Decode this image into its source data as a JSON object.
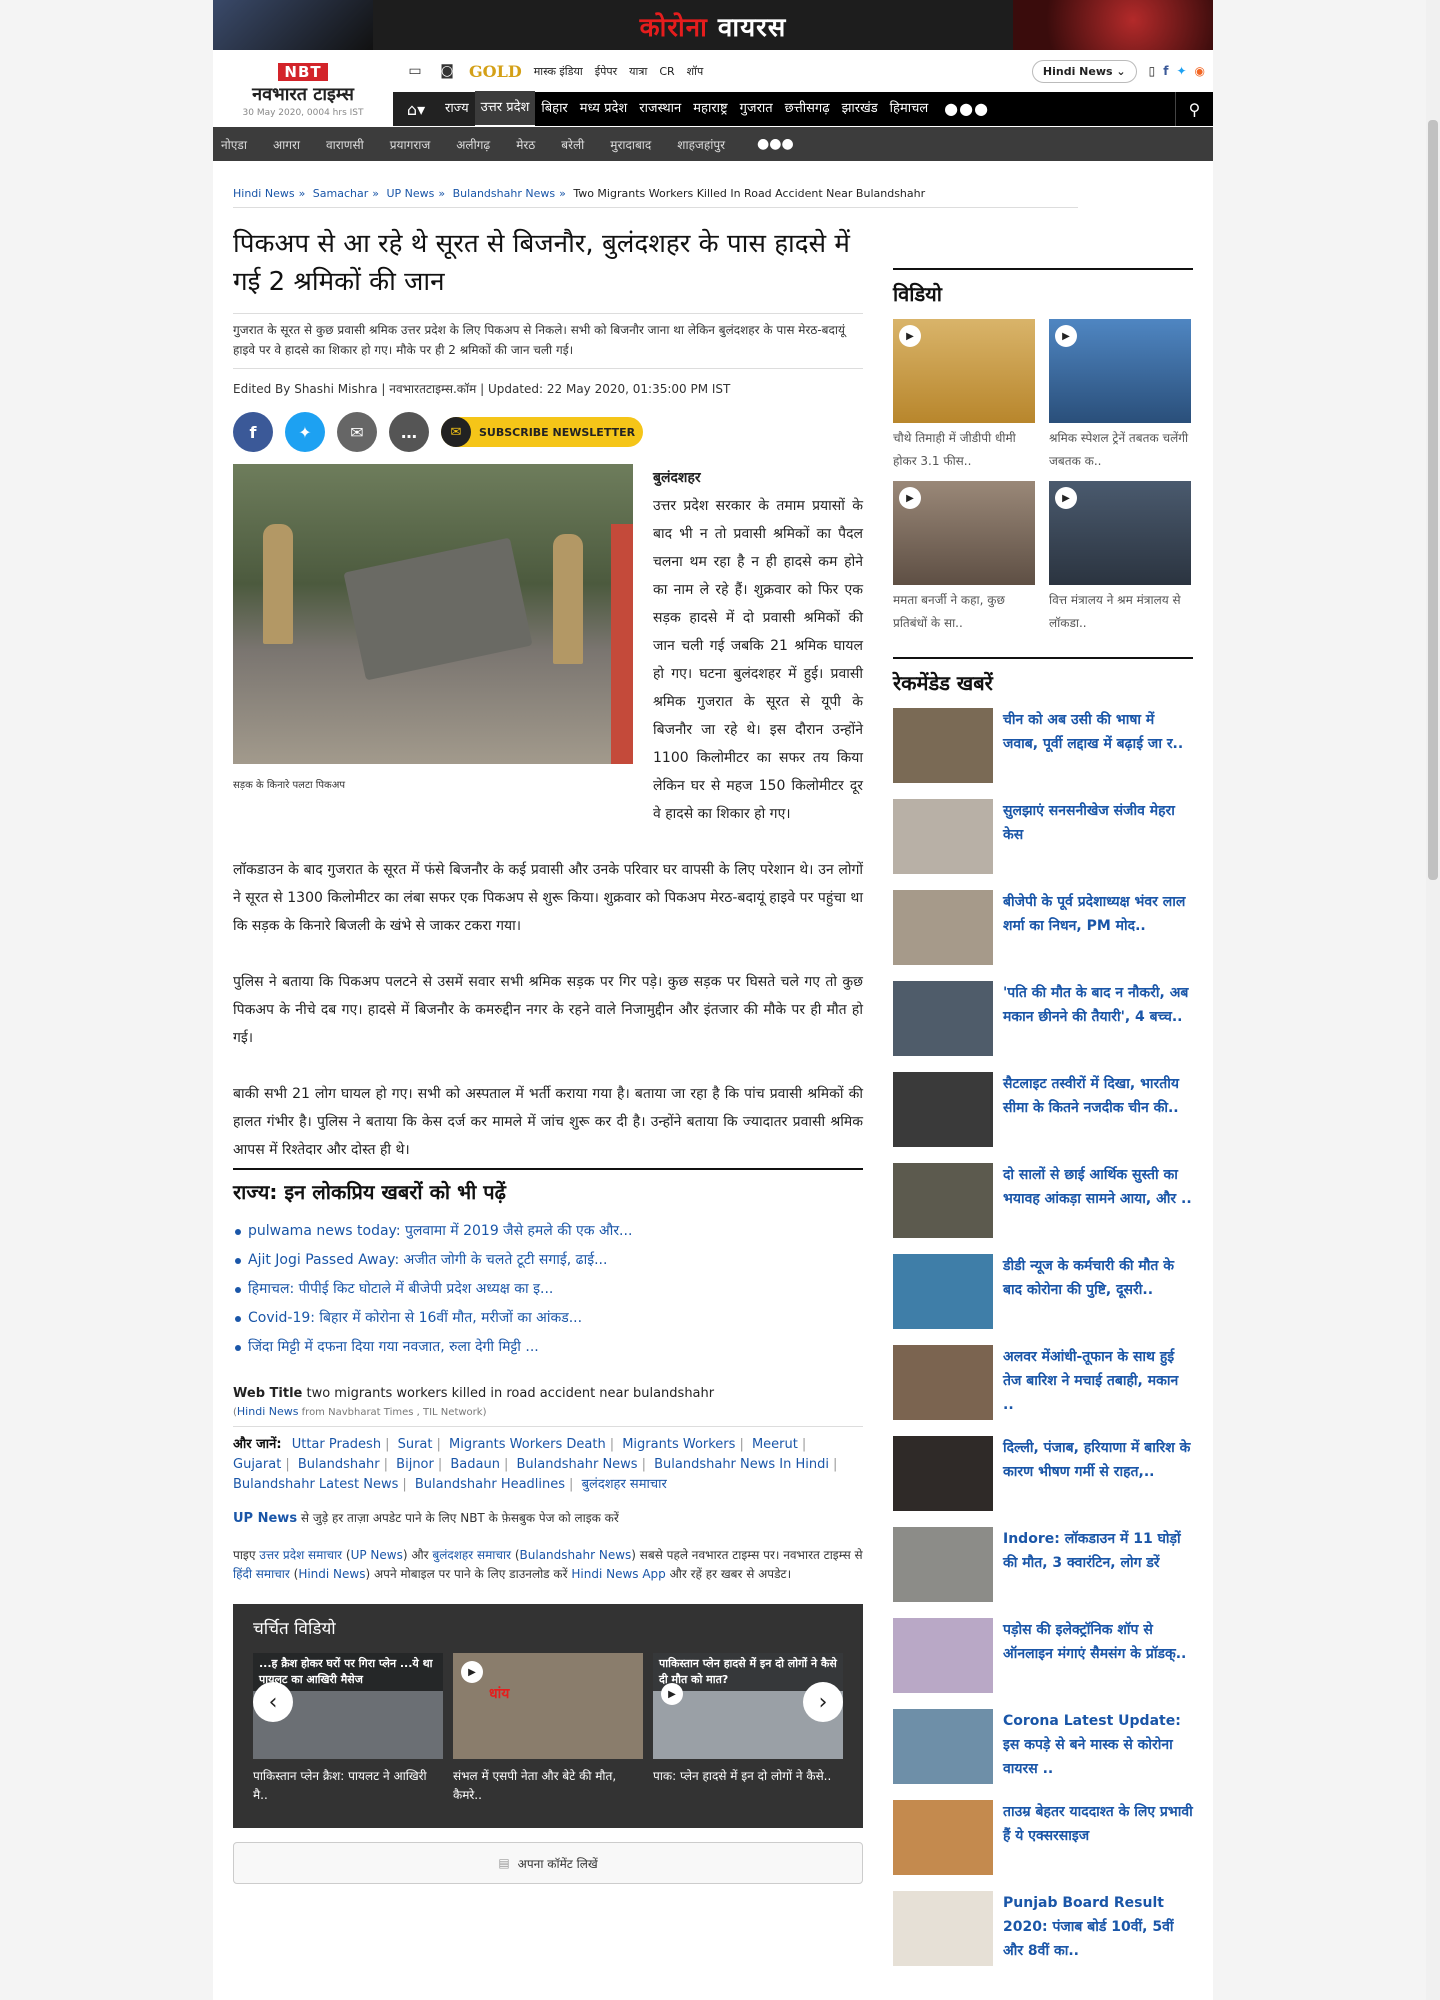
{
  "banner": {
    "text_red": "कोरोना",
    "text_white": "वायरस"
  },
  "header": {
    "logo_en": "NBT",
    "logo_hi": "नवभारत टाइम्स",
    "date": "30 May 2020, 0004 hrs IST",
    "top_links": [
      "मास्क इंडिया",
      "ईपेपर",
      "यात्रा",
      "CR",
      "शॉप"
    ],
    "gold": "GOLD",
    "lang": "Hindi News ⌄",
    "nav": [
      "राज्य",
      "उत्तर प्रदेश",
      "बिहार",
      "मध्य प्रदेश",
      "राजस्थान",
      "महाराष्ट्र",
      "गुजरात",
      "छत्तीसगढ़",
      "झारखंड",
      "हिमाचल"
    ],
    "subnav": [
      "नोएडा",
      "आगरा",
      "वाराणसी",
      "प्रयागराज",
      "अलीगढ़",
      "मेरठ",
      "बरेली",
      "मुरादाबाद",
      "शाहजहांपुर"
    ],
    "more": "●●●"
  },
  "breadcrumb": {
    "items": [
      "Hindi News",
      "Samachar",
      "UP News",
      "Bulandshahr News"
    ],
    "current": "Two Migrants Workers Killed In Road Accident Near Bulandshahr"
  },
  "article": {
    "title": "पिकअप से आ रहे थे सूरत से बिजनौर, बुलंदशहर के पास हादसे में गई 2 श्रमिकों की जान",
    "summary": "गुजरात के सूरत से कुछ प्रवासी श्रमिक उत्तर प्रदेश के लिए पिकअप से निकले। सभी को बिजनौर जाना था लेकिन बुलंदशहर के पास मेरठ-बदायूं हाइवे पर वे हादसे का शिकार हो गए। मौके पर ही 2 श्रमिकों की जान चली गई।",
    "byline": "Edited By Shashi Mishra | नवभारतटाइम्स.कॉम | Updated: 22 May 2020, 01:35:00 PM IST",
    "newsletter": "SUBSCRIBE NEWSLETTER",
    "photo_caption": "सड़क के किनारे पलटा पिकअप",
    "dateline": "बुलंदशहर",
    "p1": "उत्तर प्रदेश सरकार के तमाम प्रयासों के बाद भी न तो प्रवासी श्रमिकों का पैदल चलना थम रहा है न ही हादसे कम होने का नाम ले रहे हैं। शुक्रवार को फिर एक सड़क हादसे में दो प्रवासी श्रमिकों की जान चली गई जबकि 21 श्रमिक घायल हो गए। घटना बुलंदशहर में हुई। प्रवासी श्रमिक गुजरात के सूरत से यूपी के बिजनौर जा रहे थे। इस दौरान उन्होंने 1100 किलोमीटर का सफर तय किया लेकिन घर से महज 150 किलोमीटर दूर वे हादसे का शिकार हो गए।",
    "p2": "लॉकडाउन के बाद गुजरात के सूरत में फंसे बिजनौर के कई प्रवासी और उनके परिवार घर वापसी के लिए परेशान थे। उन लोगों ने सूरत से 1300 किलोमीटर का लंबा सफर एक पिकअप से शुरू किया। शुक्रवार को पिकअप मेरठ-बदायूं हाइवे पर पहुंचा था कि सड़क के किनारे बिजली के खंभे से जाकर टकरा गया।",
    "p3": "पुलिस ने बताया कि पिकअप पलटने से उसमें सवार सभी श्रमिक सड़क पर गिर पड़े। कुछ सड़क पर घिसते चले गए तो कुछ पिकअप के नीचे दब गए। हादसे में बिजनौर के कमरुद्दीन नगर के रहने वाले निजामुद्दीन और इंतजार की मौके पर ही मौत हो गई।",
    "p4": "बाकी सभी 21 लोग घायल हो गए। सभी को अस्पताल में भर्ती कराया गया है। बताया जा रहा है कि पांच प्रवासी श्रमिकों की हालत गंभीर है। पुलिस ने बताया कि केस दर्ज कर मामले में जांच शुरू कर दी है। उन्होंने बताया कि ज्यादातर प्रवासी श्रमिक आपस में रिश्तेदार और दोस्त ही थे।"
  },
  "popular": {
    "heading": "राज्य: इन लोकप्रिय खबरों को भी पढ़ें",
    "items": [
      "pulwama news today: पुलवामा में 2019 जैसे हमले की एक और...",
      "Ajit Jogi Passed Away: अजीत जोगी के चलते टूटी सगाई, ढाई...",
      "हिमाचल: पीपीई किट घोटाले में बीजेपी प्रदेश अध्यक्ष का इ...",
      "Covid-19: बिहार में कोरोना से 16वीं मौत, मरीजों का आंकड...",
      "जिंदा मिट्टी में दफना दिया गया नवजात, रुला देगी मिट्टी ..."
    ]
  },
  "webtitle": {
    "label": "Web Title",
    "text": "two migrants workers killed in road accident near bulandshahr",
    "src_link": "Hindi News",
    "src_rest": "from Navbharat Times , TIL Network"
  },
  "tags": {
    "label": "और जानें:",
    "items": [
      "Uttar Pradesh",
      "Surat",
      "Migrants Workers Death",
      "Migrants Workers",
      "Meerut",
      "Gujarat",
      "Bulandshahr",
      "Bijnor",
      "Badaun",
      "Bulandshahr News",
      "Bulandshahr News In Hindi",
      "Bulandshahr Latest News",
      "Bulandshahr Headlines",
      "बुलंदशहर समाचार"
    ]
  },
  "fbline": {
    "link": "UP News",
    "text": "से जुड़े हर ताज़ा अपडेट पाने के लिए NBT के फ़ेसबुक पेज को लाइक करें"
  },
  "footnote": {
    "a": "पाइए",
    "l1": "उत्तर प्रदेश समाचार",
    "l2": "UP News",
    "b": "और",
    "l3": "बुलंदशहर समाचार",
    "l4": "Bulandshahr News",
    "c": "सबसे पहले नवभारत टाइम्स पर। नवभारत टाइम्स से",
    "l5": "हिंदी समाचार",
    "l6": "Hindi News",
    "d": "अपने मोबाइल पर पाने के लिए डाउनलोड करें",
    "l7": "Hindi News App",
    "e": "और रहें हर खबर से अपडेट।"
  },
  "videos": {
    "heading": "चर्चित विडियो",
    "items": [
      {
        "overlay": "...ह क्रैश होकर घरों पर गिरा प्लेन ...ये था पायलट का आखिरी मैसेज",
        "title": "पाकिस्तान प्लेन क्रैश: पायलट ने आखिरी मै..",
        "color": "#6b6f74"
      },
      {
        "overlay": "धांय",
        "title": "संभल में एसपी नेता और बेटे की मौत, कैमरे..",
        "color": "#8a7d6c"
      },
      {
        "overlay": "पाकिस्तान प्लेन हादसे में इन दो लोगों ने कैसे दी मौत को मात?",
        "title": "पाक: प्लेन हादसे में इन दो लोगों ने कैसे..",
        "color": "#9aa0a6"
      }
    ]
  },
  "comment": {
    "label": "अपना कॉमेंट लिखें"
  },
  "sidebar": {
    "video_heading": "विडियो",
    "videos": [
      {
        "title": "चौथे तिमाही में जीडीपी धीमी होकर 3.1 फीस..",
        "color": "#c9a24a"
      },
      {
        "title": "श्रमिक स्पेशल ट्रेनें तबतक चलेंगी जबतक क..",
        "color": "#3b6fa8"
      },
      {
        "title": "ममता बनर्जी ने कहा, कुछ प्रतिबंधों के सा..",
        "color": "#7a6b5e"
      },
      {
        "title": "वित्त मंत्रालय ने श्रम मंत्रालय से लॉकडा..",
        "color": "#3d4a5a"
      }
    ],
    "reco_heading": "रेकमेंडेड खबरें",
    "reco": [
      {
        "title": "चीन को अब उसी की भाषा में जवाब, पूर्वी लद्दाख में बढ़ाई जा र..",
        "color": "#7a6a55"
      },
      {
        "title": "सुलझाएं सनसनीखेज संजीव मेहरा केस",
        "color": "#b8b0a6"
      },
      {
        "title": "बीजेपी के पूर्व प्रदेशाध्यक्ष भंवर लाल शर्मा का निधन, PM मोद..",
        "color": "#a69a8a"
      },
      {
        "title": "'पति की मौत के बाद न नौकरी, अब मकान छीनने की तैयारी', 4 बच्च..",
        "color": "#4f5c6a"
      },
      {
        "title": "सैटलाइट तस्वीरों में दिखा, भारतीय सीमा के कितने नजदीक चीन की..",
        "color": "#3a3a3a"
      },
      {
        "title": "दो सालों से छाई आर्थिक सुस्ती का भयावह आंकड़ा सामने आया, और ..",
        "color": "#5c5a4e"
      },
      {
        "title": "डीडी न्यूज के कर्मचारी की मौत के बाद कोरोना की पुष्टि, दूसरी..",
        "color": "#3f7ea8"
      },
      {
        "title": "अलवर मेंआंधी-तूफान के साथ हुई तेज बारिश ने मचाई तबाही, मकान ..",
        "color": "#7b6450"
      },
      {
        "title": "दिल्ली, पंजाब, हरियाणा में बारिश के कारण भीषण गर्मी से राहत,..",
        "color": "#2f2a28"
      },
      {
        "title": "Indore: लॉकडाउन में 11 घोड़ों की मौत, 3 क्वारंटिन, लोग डरें",
        "color": "#8c8c88"
      },
      {
        "title": "पड़ोस की इलेक्ट्रॉनिक शॉप से ऑनलाइन मंगाएं सैमसंग के प्रॉडक्..",
        "color": "#b9a8c6"
      },
      {
        "title": "Corona Latest Update: इस कपड़े से बने मास्क से कोरोना वायरस ..",
        "color": "#6e8fa8"
      },
      {
        "title": "ताउम्र बेहतर याददाश्त के लिए प्रभावी हैं ये एक्सरसाइज",
        "color": "#c48a4e"
      },
      {
        "title": "Punjab Board Result 2020: पंजाब बोर्ड 10वीं, 5वीं और 8वीं का..",
        "color": "#e6e0d6"
      }
    ]
  }
}
